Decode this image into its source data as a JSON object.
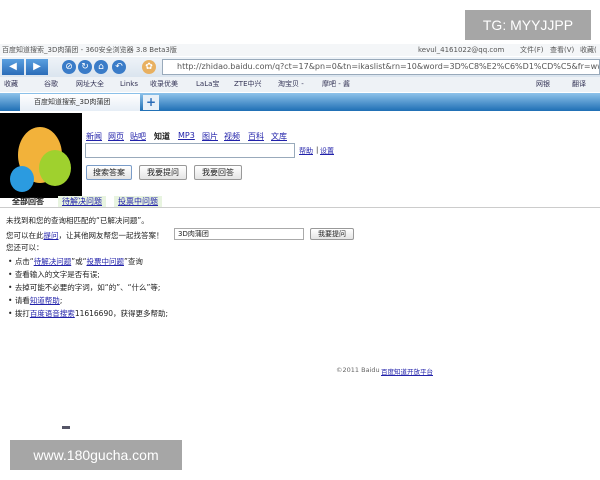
{
  "watermark_top": "TG: MYYJJPP",
  "watermark_bottom": "www.180gucha.com",
  "browser": {
    "title": "百度知道搜索_3D肉蒲团 - 360安全浏览器 3.8 Beta3版",
    "account": "kevul_4161022@qq.com",
    "menu": [
      "文件(F)",
      "查看(V)",
      "收藏("
    ],
    "url": "http://zhidao.baidu.com/q?ct=17&pn=0&tn=ikaslist&rn=10&word=3D%C8%E2%C6%D1%CD%C5&fr=wwwt",
    "favorites": [
      "收藏",
      "谷歌",
      "网址大全",
      "Links",
      "收录优美",
      "LaLa宝",
      "ZTE中兴",
      "淘宝贝 -",
      "摩吧 - 酱"
    ],
    "right_tools": [
      "网银",
      "翻译"
    ],
    "tab_title": "百度知道搜索_3D肉蒲团",
    "new_tab": "+",
    "accent": "#2a6cb8"
  },
  "page": {
    "nav": [
      "新闻",
      "网页",
      "贴吧",
      "知道",
      "MP3",
      "图片",
      "视频",
      "百科",
      "文库"
    ],
    "search_value": "",
    "help": "帮助",
    "sep": "|",
    "settings": "设置",
    "buttons": [
      "搜索答案",
      "我要提问",
      "我要回答"
    ],
    "tabs": [
      "全部回答",
      "待解决问题",
      "投票中问题"
    ],
    "no_result": "未找到和您的查询相匹配的“已解决问题”。",
    "ask_prefix": "您可以在此",
    "ask_link": "提问",
    "ask_suffix": "，让其他网友帮您一起找答案！",
    "ask_value": "3D肉蒲团",
    "ask_button": "我要提问",
    "also": "您还可以：",
    "tips": {
      "t1a": "点击“",
      "t1l1": "待解决问题",
      "t1b": "”或“",
      "t1l2": "投票中问题",
      "t1c": "”查询",
      "t2": "查看输入的文字是否有误;",
      "t3": "去掉可能不必要的字词，如“的”、“什么”等;",
      "t4a": "请看",
      "t4l": "知道帮助",
      "t4b": ";",
      "t5a": "拨打",
      "t5l": "百度语音搜索",
      "t5b": "11616690，获得更多帮助;"
    },
    "copyright": "©2011 Baidu",
    "footer_link": "百度知道开放平台"
  }
}
